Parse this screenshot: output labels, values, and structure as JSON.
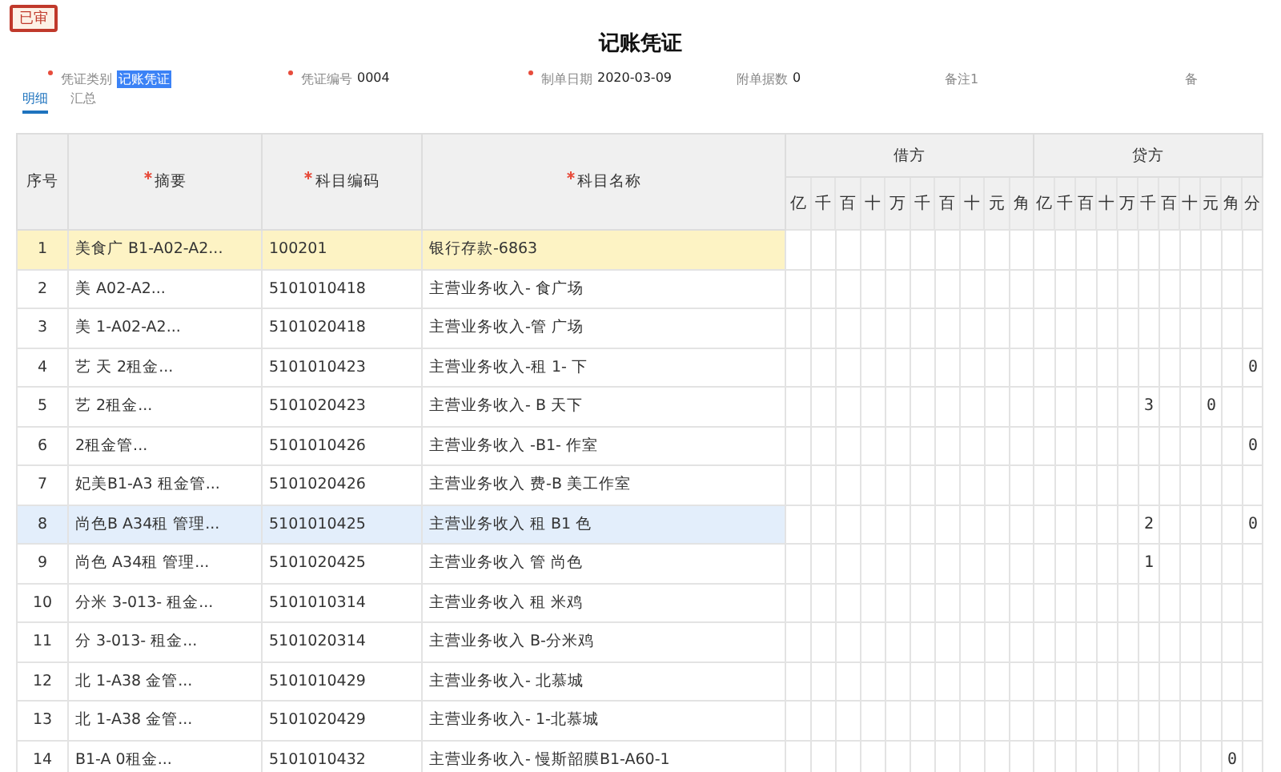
{
  "status_stamp": "已审",
  "title": "记账凭证",
  "fields": [
    {
      "label": "凭证类别",
      "value": "记账凭证",
      "required": true,
      "highlighted": true
    },
    {
      "label": "凭证编号",
      "value": "0004",
      "required": true
    },
    {
      "label": "制单日期",
      "value": "2020-03-09",
      "required": true
    },
    {
      "label": "附单据数",
      "value": "0",
      "required": false
    },
    {
      "label": "备注1",
      "required": false
    },
    {
      "label": "备",
      "required": false
    }
  ],
  "tabs": [
    {
      "label": "明细",
      "selected": true
    },
    {
      "label": "汇总",
      "selected": false
    }
  ],
  "table": {
    "columns": [
      {
        "label": "序号",
        "required": false
      },
      {
        "label": "摘要",
        "required": true
      },
      {
        "label": "科目编码",
        "required": true
      },
      {
        "label": "科目名称",
        "required": true
      }
    ],
    "debit": {
      "label": "借方",
      "units": [
        "亿",
        "千",
        "百",
        "十",
        "万",
        "千",
        "百",
        "十",
        "元",
        "角"
      ]
    },
    "credit": {
      "label": "贷方",
      "units": [
        "亿",
        "千",
        "百",
        "十",
        "万",
        "千",
        "百",
        "十",
        "元",
        "角",
        "分"
      ]
    },
    "rows": [
      {
        "no": "1",
        "summary": "美食广 B1-A02-A2...",
        "code": "100201",
        "account": "银行存款-6863",
        "selected": true,
        "hover": false
      },
      {
        "no": "2",
        "summary": "美 A02-A2...",
        "code": "5101010418",
        "account": "主营业务收入- 食广场",
        "selected": false,
        "hover": false
      },
      {
        "no": "3",
        "summary": "美 1-A02-A2...",
        "code": "5101020418",
        "account": "主营业务收入-管 广场",
        "selected": false,
        "hover": false
      },
      {
        "no": "4",
        "summary": "艺 天 2租金...",
        "code": "5101010423",
        "account": "主营业务收入-租 1- 下",
        "selected": false,
        "hover": false,
        "credit": "          0"
      },
      {
        "no": "5",
        "summary": "艺 2租金...",
        "code": "5101020423",
        "account": "主营业务收入- B 天下",
        "selected": false,
        "hover": false,
        "credit": "     3  0  "
      },
      {
        "no": "6",
        "summary": "2租金管...",
        "code": "5101010426",
        "account": "主营业务收入 -B1- 作室",
        "selected": false,
        "hover": false,
        "credit": "          0"
      },
      {
        "no": "7",
        "summary": "妃美B1-A3 租金管...",
        "code": "5101020426",
        "account": "主营业务收入 费-B 美工作室",
        "selected": false,
        "hover": false
      },
      {
        "no": "8",
        "summary": "尚色B A34租 管理...",
        "code": "5101010425",
        "account": "主营业务收入 租 B1 色",
        "selected": false,
        "hover": true,
        "credit": "     2    0"
      },
      {
        "no": "9",
        "summary": "尚色 A34租 管理...",
        "code": "5101020425",
        "account": "主营业务收入 管 尚色",
        "selected": false,
        "hover": false,
        "credit": "     1     "
      },
      {
        "no": "10",
        "summary": "分米 3-013- 租金...",
        "code": "5101010314",
        "account": "主营业务收入 租 米鸡",
        "selected": false,
        "hover": false
      },
      {
        "no": "11",
        "summary": "分 3-013- 租金...",
        "code": "5101020314",
        "account": "主营业务收入 B-分米鸡",
        "selected": false,
        "hover": false
      },
      {
        "no": "12",
        "summary": "北 1-A38 金管...",
        "code": "5101010429",
        "account": "主营业务收入- 北慕城",
        "selected": false,
        "hover": false
      },
      {
        "no": "13",
        "summary": "北 1-A38 金管...",
        "code": "5101020429",
        "account": "主营业务收入- 1-北慕城",
        "selected": false,
        "hover": false
      },
      {
        "no": "14",
        "summary": "B1-A 0租金...",
        "code": "5101010432",
        "account": "主营业务收入- 慢斯韶膜B1-A60-1",
        "selected": false,
        "hover": false,
        "credit": "         0 "
      }
    ]
  }
}
